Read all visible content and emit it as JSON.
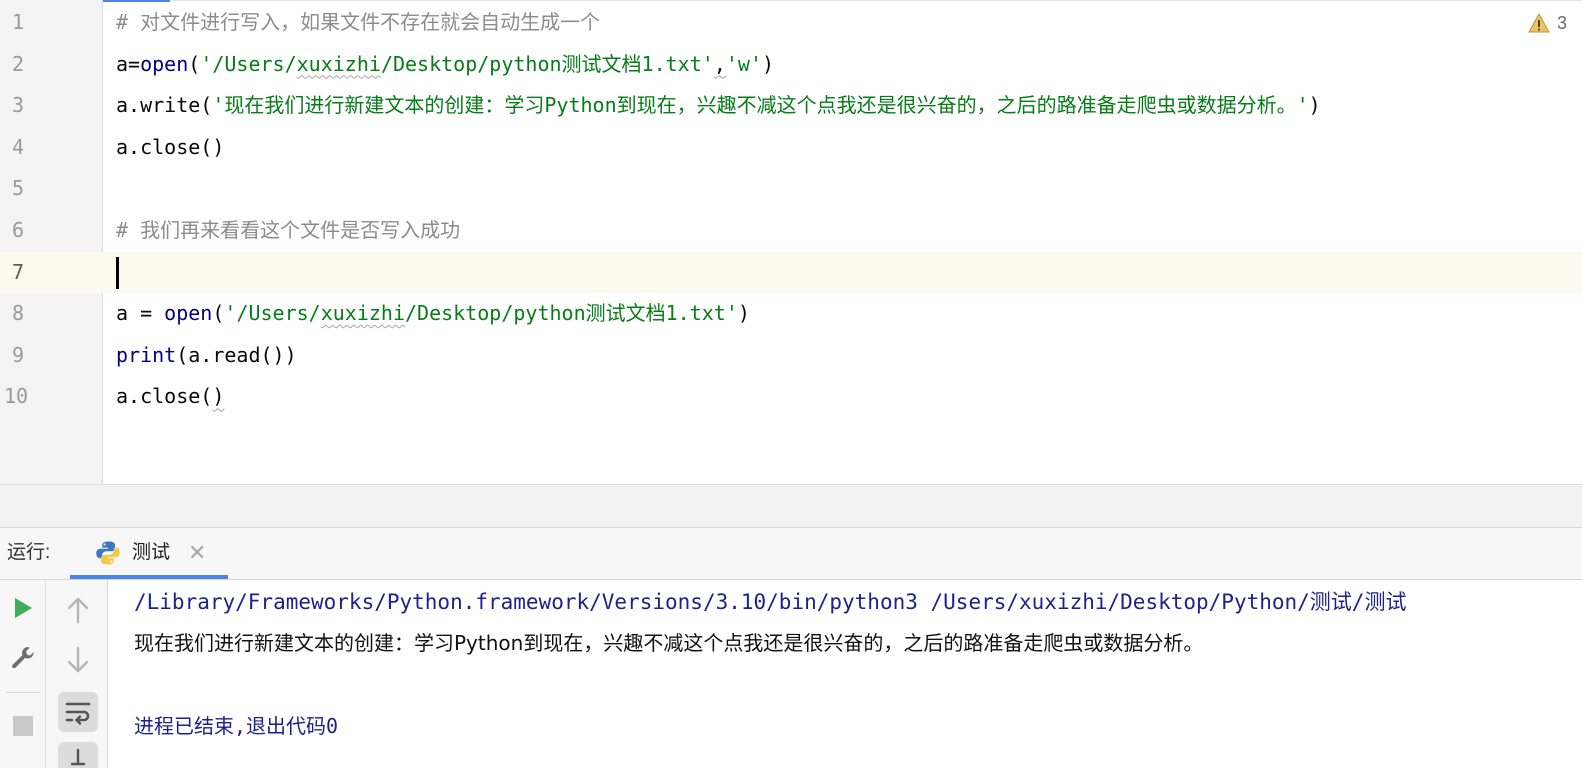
{
  "editor": {
    "warning_count": "3",
    "lines": [
      {
        "num": "1",
        "tokens": [
          {
            "t": "comment",
            "v": "# 对文件进行写入，如果文件不存在就会自动生成一个"
          }
        ]
      },
      {
        "num": "2",
        "tokens": [
          {
            "t": "plain",
            "v": "a="
          },
          {
            "t": "builtin",
            "v": "open"
          },
          {
            "t": "plain",
            "v": "("
          },
          {
            "t": "str",
            "v": "'/Users/"
          },
          {
            "t": "str-wavy",
            "v": "xuxizhi"
          },
          {
            "t": "str",
            "v": "/Desktop/python测试文档1.txt'"
          },
          {
            "t": "plain-wavy",
            "v": ","
          },
          {
            "t": "str",
            "v": "'w'"
          },
          {
            "t": "plain",
            "v": ")"
          }
        ]
      },
      {
        "num": "3",
        "tokens": [
          {
            "t": "plain",
            "v": "a.write("
          },
          {
            "t": "str",
            "v": "'现在我们进行新建文本的创建：学习Python到现在，兴趣不减这个点我还是很兴奋的，之后的路准备走爬虫或数据分析。'"
          },
          {
            "t": "plain",
            "v": ")"
          }
        ]
      },
      {
        "num": "4",
        "tokens": [
          {
            "t": "plain",
            "v": "a.close()"
          }
        ]
      },
      {
        "num": "5",
        "tokens": []
      },
      {
        "num": "6",
        "tokens": [
          {
            "t": "comment",
            "v": "# 我们再来看看这个文件是否写入成功"
          }
        ]
      },
      {
        "num": "7",
        "tokens": [],
        "current": true
      },
      {
        "num": "8",
        "tokens": [
          {
            "t": "plain",
            "v": "a = "
          },
          {
            "t": "builtin",
            "v": "open"
          },
          {
            "t": "plain",
            "v": "("
          },
          {
            "t": "str",
            "v": "'/Users/"
          },
          {
            "t": "str-wavy",
            "v": "xuxizhi"
          },
          {
            "t": "str",
            "v": "/Desktop/python测试文档1.txt'"
          },
          {
            "t": "plain",
            "v": ")"
          }
        ]
      },
      {
        "num": "9",
        "tokens": [
          {
            "t": "builtin",
            "v": "print"
          },
          {
            "t": "plain",
            "v": "(a.read())"
          }
        ]
      },
      {
        "num": "10",
        "tokens": [
          {
            "t": "plain",
            "v": "a.close("
          },
          {
            "t": "plain-wavy",
            "v": ")"
          }
        ]
      }
    ]
  },
  "run": {
    "label": "运行:",
    "tab_label": "测试",
    "tab_close": "✕",
    "console": {
      "command": "/Library/Frameworks/Python.framework/Versions/3.10/bin/python3 /Users/xuxizhi/Desktop/Python/测试/测试",
      "output": "现在我们进行新建文本的创建：学习Python到现在，兴趣不减这个点我还是很兴奋的，之后的路准备走爬虫或数据分析。",
      "exit": "进程已结束,退出代码0"
    },
    "toolbar": {
      "run_icon": "play-icon",
      "settings_icon": "wrench-icon",
      "stop_icon": "stop-icon",
      "up_icon": "arrow-up-icon",
      "down_icon": "arrow-down-icon",
      "softwrap_icon": "soft-wrap-icon"
    }
  },
  "colors": {
    "comment": "#8c8c8c",
    "builtin": "#000080",
    "string": "#067d17",
    "accent": "#4a86e8",
    "run_green": "#3fae5b"
  }
}
